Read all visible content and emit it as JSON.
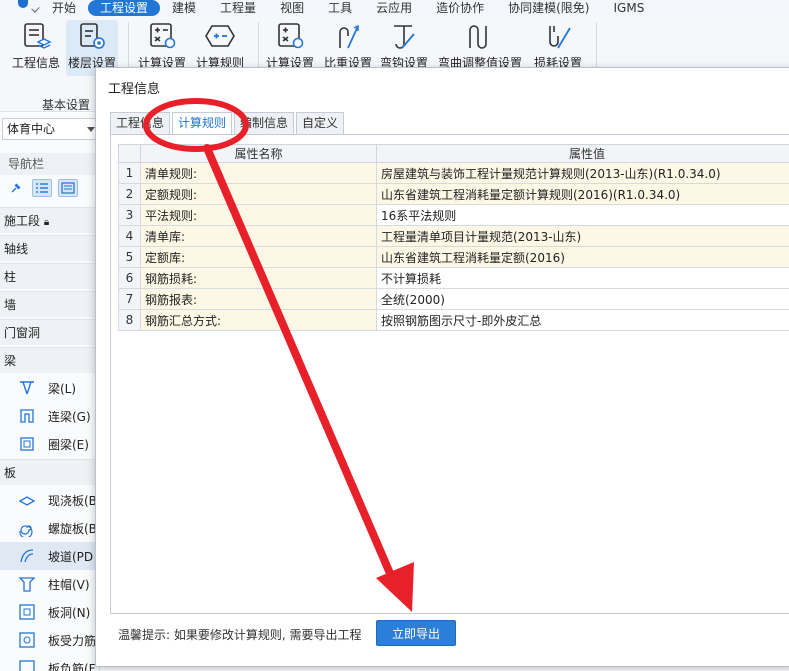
{
  "menubar": {
    "items": [
      "开始",
      "工程设置",
      "建模",
      "工程量",
      "视图",
      "工具",
      "云应用",
      "造价协作",
      "协同建模(限免)",
      "IGMS"
    ]
  },
  "ribbon": {
    "buttons": [
      "工程信息",
      "楼层设置",
      "计算设置",
      "计算规则",
      "计算设置",
      "比重设置",
      "弯钩设置",
      "弯曲调整值设置",
      "损耗设置"
    ],
    "group_label": "基本设置"
  },
  "sidebar": {
    "select_value": "体育中心",
    "nav_title": "导航栏",
    "categories": {
      "c0": "施工段",
      "c1": "轴线",
      "c2": "柱",
      "c3": "墙",
      "c4": "门窗洞",
      "c5": "梁",
      "c6": "板"
    },
    "beam_items": [
      "梁(L)",
      "连梁(G)",
      "圈梁(E)"
    ],
    "slab_items": [
      "现浇板(B",
      "螺旋板(B",
      "坡道(PD",
      "柱帽(V)",
      "板洞(N)",
      "板受力筋",
      "板负筋(F"
    ]
  },
  "dialog": {
    "title": "工程信息",
    "tabs": [
      "工程信息",
      "计算规则",
      "编制信息",
      "自定义"
    ],
    "columns": [
      "属性名称",
      "属性值"
    ],
    "rows": [
      {
        "num": "1",
        "name": "清单规则:",
        "value": "房屋建筑与装饰工程计量规范计算规则(2013-山东)(R1.0.34.0)"
      },
      {
        "num": "2",
        "name": "定额规则:",
        "value": "山东省建筑工程消耗量定额计算规则(2016)(R1.0.34.0)"
      },
      {
        "num": "3",
        "name": "平法规则:",
        "value": "16系平法规则"
      },
      {
        "num": "4",
        "name": "清单库:",
        "value": "工程量清单项目计量规范(2013-山东)"
      },
      {
        "num": "5",
        "name": "定额库:",
        "value": "山东省建筑工程消耗量定额(2016)"
      },
      {
        "num": "6",
        "name": "钢筋损耗:",
        "value": "不计算损耗"
      },
      {
        "num": "7",
        "name": "钢筋报表:",
        "value": "全统(2000)"
      },
      {
        "num": "8",
        "name": "钢筋汇总方式:",
        "value": "按照钢筋图示尺寸-即外皮汇总"
      }
    ],
    "tip": "温馨提示: 如果要修改计算规则, 需要导出工程",
    "export_button": "立即导出"
  },
  "colors": {
    "accent": "#2176d6",
    "annotation": "#e8202a",
    "cell_yellow": "#fdf8e6"
  }
}
